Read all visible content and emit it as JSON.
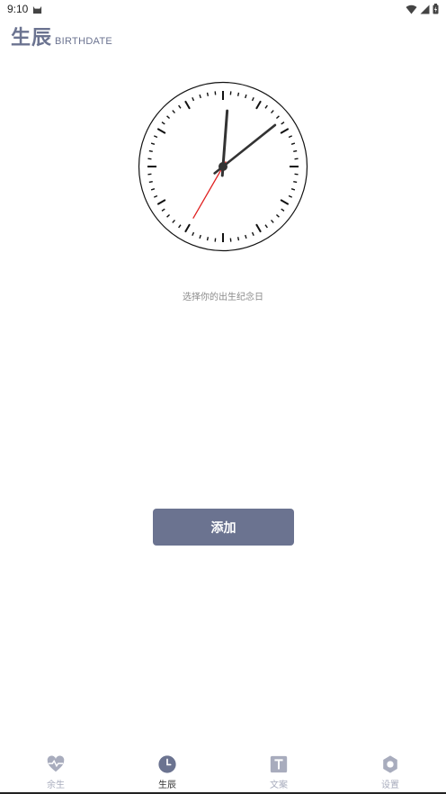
{
  "status_bar": {
    "time": "9:10"
  },
  "header": {
    "title": "生辰",
    "subtitle": "BIRTHDATE"
  },
  "clock": {
    "hour": 12,
    "minute": 8,
    "second": 35
  },
  "prompt": "选择你的出生纪念日",
  "add_button": {
    "label": "添加"
  },
  "tabs": [
    {
      "label": "余生",
      "icon": "heart-pulse-icon",
      "active": false
    },
    {
      "label": "生辰",
      "icon": "clock-icon",
      "active": true
    },
    {
      "label": "文案",
      "icon": "text-icon",
      "active": false
    },
    {
      "label": "设置",
      "icon": "gear-icon",
      "active": false
    }
  ],
  "colors": {
    "accent": "#6b7390",
    "inactive": "#a8acbd",
    "second_hand": "#e02020"
  }
}
